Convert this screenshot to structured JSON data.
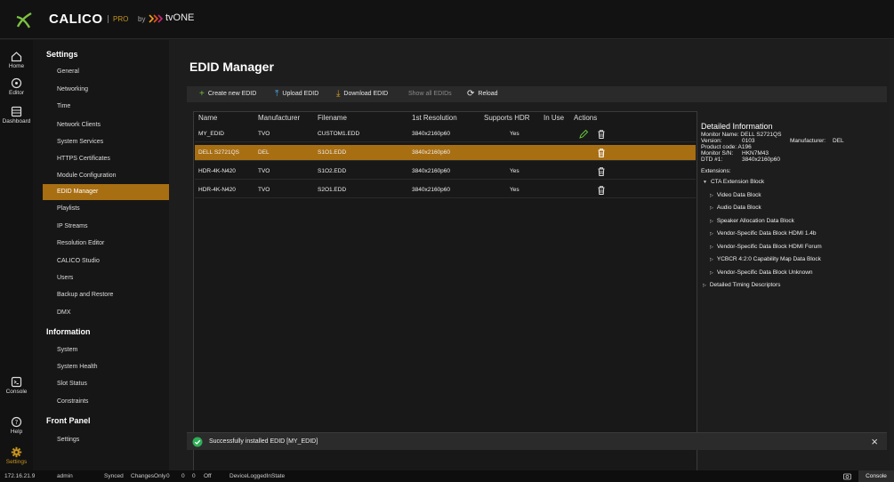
{
  "brand": {
    "name": "CALICO",
    "edition": "PRO",
    "by": "by",
    "partner": "tvONE"
  },
  "rail": [
    {
      "label": "Home",
      "icon": "home-icon"
    },
    {
      "label": "Editor",
      "icon": "editor-icon"
    },
    {
      "label": "Dashboard",
      "icon": "dashboard-icon"
    },
    {
      "label": "Console",
      "icon": "console-icon"
    },
    {
      "label": "Help",
      "icon": "help-icon"
    },
    {
      "label": "Settings",
      "icon": "gear-icon"
    }
  ],
  "menu": {
    "settings_heading": "Settings",
    "settings_items": [
      "General",
      "Networking",
      "Time",
      "Network Clients",
      "System Services",
      "HTTPS Certificates",
      "Module Configuration",
      "EDID Manager",
      "Playlists",
      "IP Streams",
      "Resolution Editor",
      "CALICO Studio",
      "Users",
      "Backup and Restore",
      "DMX"
    ],
    "information_heading": "Information",
    "information_items": [
      "System",
      "System Health",
      "Slot Status",
      "Constraints"
    ],
    "front_panel_heading": "Front Panel",
    "front_panel_items": [
      "Settings"
    ]
  },
  "page": {
    "title": "EDID Manager"
  },
  "toolbar": {
    "create": "Create new EDID",
    "upload": "Upload EDID",
    "download": "Download EDID",
    "show_all": "Show all EDIDs",
    "reload": "Reload"
  },
  "table": {
    "headers": {
      "name": "Name",
      "manufacturer": "Manufacturer",
      "filename": "Filename",
      "resolution": "1st Resolution",
      "hdr": "Supports HDR",
      "in_use": "In Use",
      "actions": "Actions"
    },
    "rows": [
      {
        "name": "MY_EDID",
        "manufacturer": "TVO",
        "filename": "CUSTOM1.EDD",
        "resolution": "3840x2160p60",
        "hdr": "Yes"
      },
      {
        "name": "DELL S2721QS",
        "manufacturer": "DEL",
        "filename": "S1O1.EDD",
        "resolution": "3840x2160p60",
        "hdr": ""
      },
      {
        "name": "HDR-4K-N420",
        "manufacturer": "TVO",
        "filename": "S1O2.EDD",
        "resolution": "3840x2160p60",
        "hdr": "Yes"
      },
      {
        "name": "HDR-4K-N420",
        "manufacturer": "TVO",
        "filename": "S2O1.EDD",
        "resolution": "3840x2160p60",
        "hdr": "Yes"
      }
    ]
  },
  "details": {
    "heading": "Detailed Information",
    "monitor_name": "Monitor Name: DELL S2721QS",
    "version_label": "Version:",
    "version_value": "0103",
    "manufacturer_label": "Manufacturer:",
    "manufacturer_value": "DEL",
    "product_code": "Product code: A196",
    "serial_label": "Monitor S/N:",
    "serial_value": "HKN7M43",
    "dtd_label": "DTD #1:",
    "dtd_value": "3840x2160p60",
    "extensions_label": "Extensions:",
    "root": "CTA Extension Block",
    "blocks": [
      "Video Data Block",
      "Audio Data Block",
      "Speaker Allocation Data Block",
      "Vendor-Specific Data Block HDMI 1.4b",
      "Vendor-Specific Data Block HDMI Forum",
      "YCBCR 4:2:0 Capability Map Data Block",
      "Vendor-Specific Data Block Unknown"
    ],
    "timing": "Detailed Timing Descriptors"
  },
  "toast": {
    "message": "Successfully installed EDID [MY_EDID]"
  },
  "status": {
    "ip": "172.16.21.9",
    "user": "admin",
    "synced": "Synced",
    "changes": "ChangesOnly",
    "changes_count": "0",
    "val1": "0",
    "val2": "0",
    "off": "Off",
    "state": "DeviceLoggedInState",
    "console": "Console"
  },
  "colors": {
    "accent": "#a86e12",
    "success": "#2fae57",
    "edit": "#69c33b"
  }
}
